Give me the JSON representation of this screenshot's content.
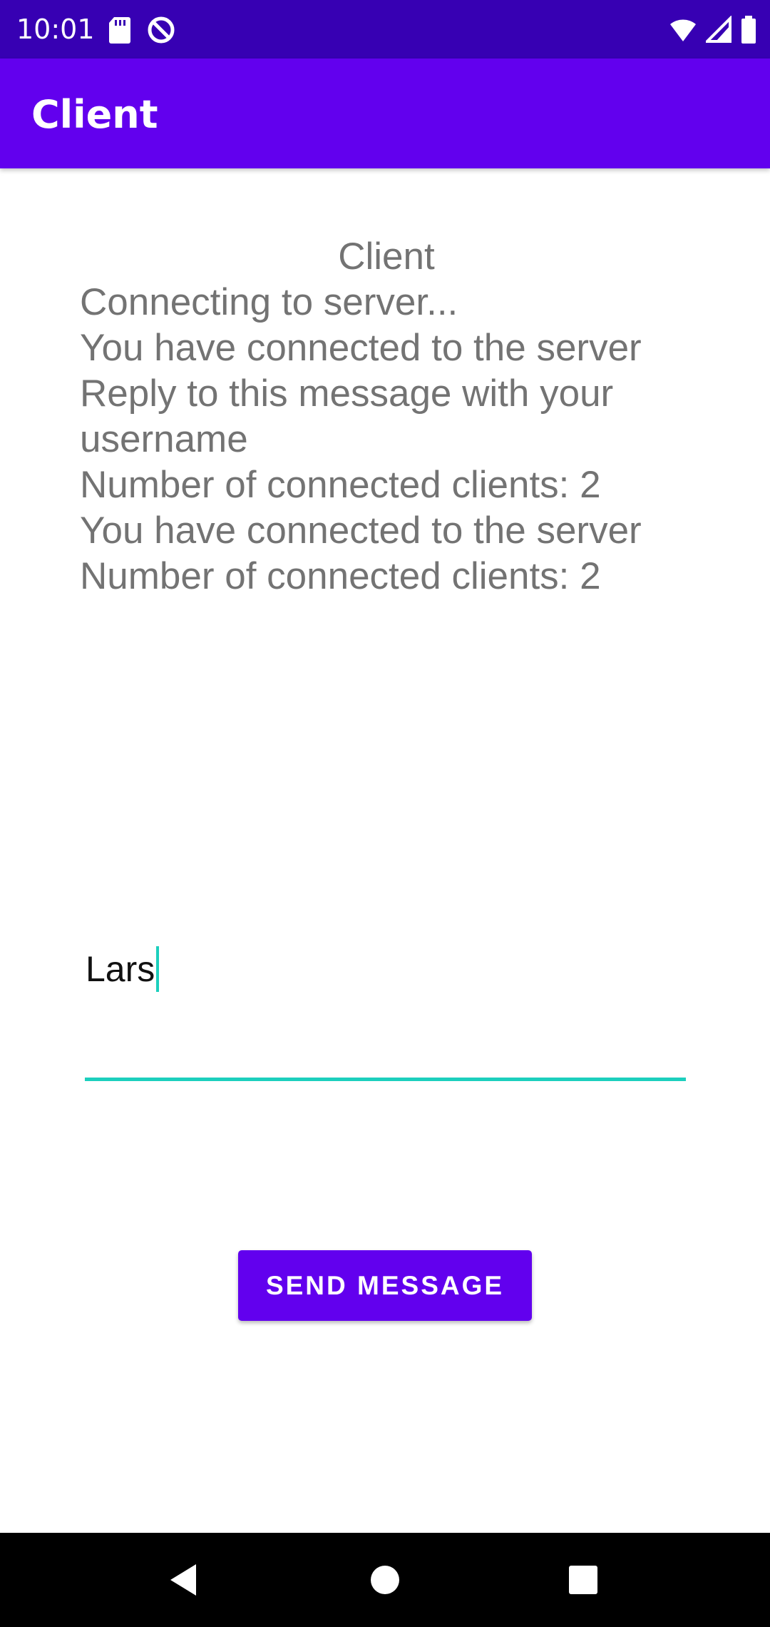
{
  "status_bar": {
    "time": "10:01",
    "icons": [
      "sd-card-icon",
      "at-sign-icon",
      "wifi-icon",
      "cell-signal-icon",
      "battery-icon"
    ]
  },
  "app_bar": {
    "title": "Client"
  },
  "console": {
    "title": "Client",
    "lines": [
      "Connecting to server...",
      "You have connected to the server",
      "Reply to this message with your username",
      "Number of connected clients: 2",
      "You have connected to the server",
      "Number of connected clients: 2"
    ]
  },
  "message_input": {
    "value": "Lars"
  },
  "send_button": {
    "label": "SEND MESSAGE"
  },
  "colors": {
    "status_bar": "#3700b3",
    "app_bar": "#6200ee",
    "accent": "#1ccfbd",
    "button": "#6200ee"
  },
  "nav_bar": {
    "icons": [
      "back-icon",
      "home-icon",
      "recents-icon"
    ]
  }
}
